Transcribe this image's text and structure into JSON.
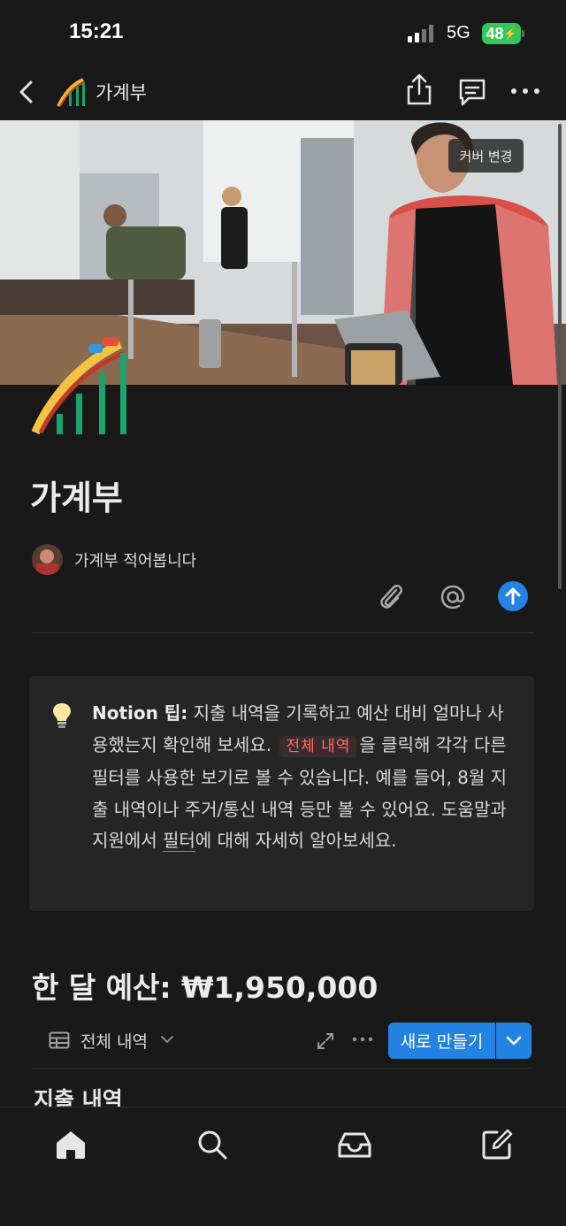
{
  "status": {
    "time": "15:21",
    "network": "5G",
    "battery": "48"
  },
  "nav": {
    "title": "가계부",
    "icons": [
      "back-icon",
      "roller-coaster-icon",
      "share-icon",
      "comment-icon",
      "more-icon"
    ]
  },
  "cover": {
    "change_label": "커버 변경"
  },
  "page": {
    "title": "가계부",
    "description": "가계부 적어봅니다"
  },
  "callout": {
    "bold": "Notion 팁:",
    "text1": " 지출 내역을 기록하고 예산 대비 얼마나 사용했는지 확인해 보세요. ",
    "tag": "전체 내역",
    "text2": "을 클릭해 각각 다른 필터를 사용한 보기로 볼 수 있습니다. 예를 들어, 8월 지출 내역이나 주거/통신 내역 등만 볼 수 있어요. 도움말과 지원에서 ",
    "link": "필터",
    "text3": "에 대해 자세히 알아보세요."
  },
  "budget": {
    "heading": "한 달 예산: ₩1,950,000"
  },
  "view": {
    "label": "전체 내역",
    "new_button": "새로 만들기"
  },
  "section": {
    "heading": "지출 내역"
  },
  "colors": {
    "accent": "#2383e2",
    "tag_red": "#ff6b6b",
    "background": "#191919"
  }
}
